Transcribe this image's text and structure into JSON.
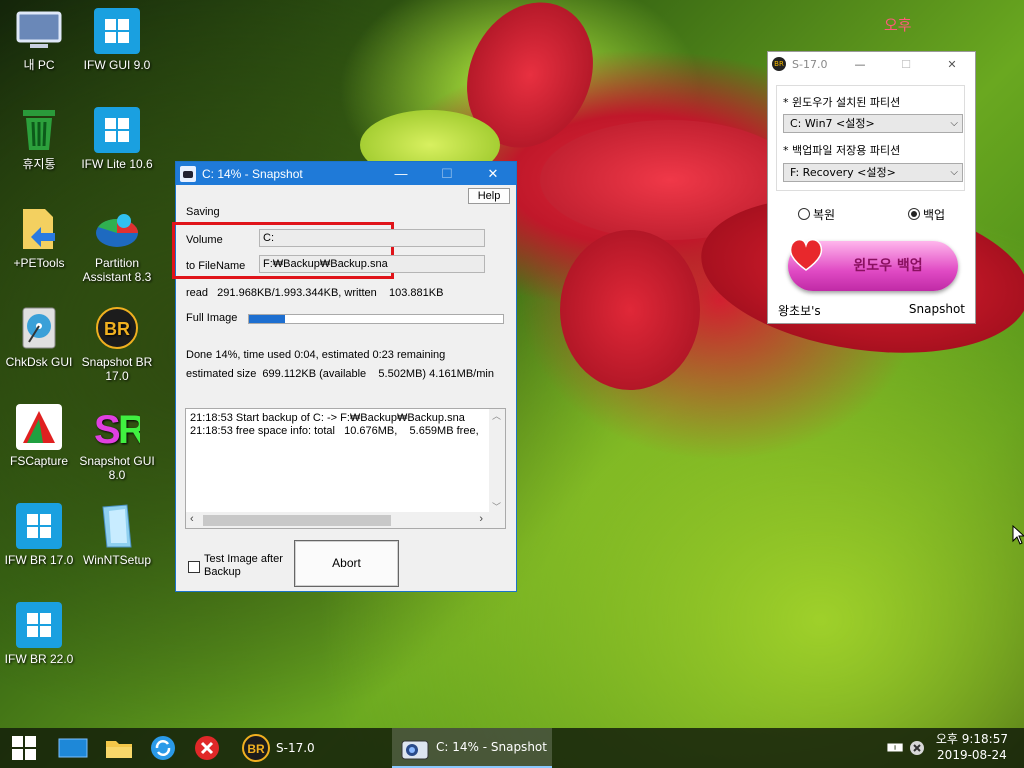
{
  "desktop": {
    "icons": [
      {
        "label": "내 PC",
        "icon": "monitor-icon"
      },
      {
        "label": "휴지통",
        "icon": "recycle-bin-icon"
      },
      {
        "label": "+PETools",
        "icon": "folder-arrow-icon"
      },
      {
        "label": "ChkDsk GUI",
        "icon": "disk-icon"
      },
      {
        "label": "FSCapture",
        "icon": "fscapture-icon"
      },
      {
        "label": "IFW BR 17.0",
        "icon": "windows-tile-icon"
      },
      {
        "label": "IFW BR 22.0",
        "icon": "windows-tile-icon"
      },
      {
        "label": "IFW GUI 9.0",
        "icon": "windows-tile-icon"
      },
      {
        "label": "IFW Lite 10.6",
        "icon": "windows-tile-icon"
      },
      {
        "label": "Partition Assistant 8.3",
        "icon": "partition-icon"
      },
      {
        "label": "Snapshot BR 17.0",
        "icon": "br-badge-icon"
      },
      {
        "label": "Snapshot GUI 8.0",
        "icon": "sr-icon"
      },
      {
        "label": "WinNTSetup",
        "icon": "winntsetup-icon"
      }
    ],
    "widget_text": "오후"
  },
  "snapshot_window": {
    "title": "C: 14% - Snapshot",
    "help_label": "Help",
    "saving_label": "Saving",
    "volume_label": "Volume",
    "volume_value": "C:",
    "filename_label": "to FileName",
    "filename_value": "F:₩Backup₩Backup.sna",
    "read_text": "read   291.968KB/1.993.344KB, written    103.881KB",
    "full_image_label": "Full Image",
    "progress_fraction": 0.14,
    "done_text": "Done 14%, time used  0:04, estimated 0:23 remaining",
    "estimated_text": "estimated size  699.112KB (available    5.502MB) 4.161MB/min",
    "log_lines": [
      "21:18:53 Start backup of C: -> F:₩Backup₩Backup.sna",
      "21:18:53 free space info: total   10.676MB,    5.659MB free,"
    ],
    "test_image_label_1": "Test Image after",
    "test_image_label_2": "Backup",
    "abort_label": "Abort"
  },
  "s17_window": {
    "title": "S-17.0",
    "badge": "BR",
    "windows_partition_label": "* 윈도우가 설치된 파티션",
    "windows_partition_value": "C: Win7 <설정>",
    "backup_partition_label": "* 백업파일 저장용 파티션",
    "backup_partition_value": "F: Recovery <설정>",
    "restore_label": "복원",
    "backup_label": "백업",
    "selected_mode": "backup",
    "action_button_label": "윈도우 백업",
    "footer_left": "왕초보's",
    "footer_right": "Snapshot"
  },
  "taskbar": {
    "apps": [
      {
        "label": "S-17.0",
        "badge": "BR"
      },
      {
        "label": "C: 14% - Snapshot"
      }
    ],
    "clock_time": "오후 9:18:57",
    "clock_date": "2019-08-24"
  }
}
